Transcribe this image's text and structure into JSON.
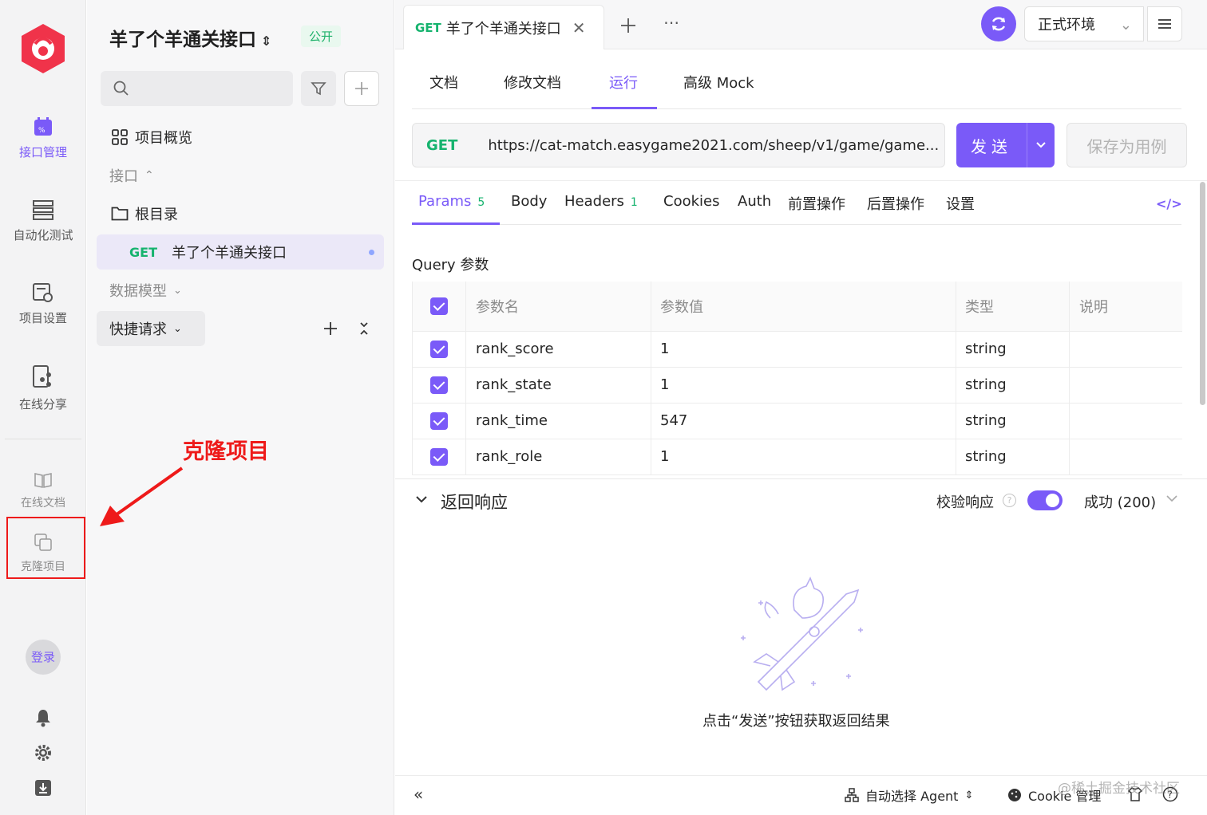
{
  "rail": {
    "items": [
      {
        "label": "接口管理",
        "icon": "api-icon"
      },
      {
        "label": "自动化测试",
        "icon": "automation-icon"
      },
      {
        "label": "项目设置",
        "icon": "settings-icon"
      },
      {
        "label": "在线分享",
        "icon": "share-icon"
      }
    ],
    "online_docs": "在线文档",
    "clone_project": "克隆项目",
    "login": "登录"
  },
  "tree": {
    "project_name": "羊了个羊通关接口",
    "public_badge": "公开",
    "search_placeholder": "",
    "overview": "项目概览",
    "section_api": "接口",
    "root_folder": "根目录",
    "api_method": "GET",
    "api_name": "羊了个羊通关接口",
    "data_model": "数据模型",
    "quick_request": "快捷请求"
  },
  "annotation": {
    "text": "克隆项目",
    "color": "#ee1a1a"
  },
  "topbar": {
    "tab_method": "GET",
    "tab_title": "羊了个羊通关接口",
    "environment": "正式环境"
  },
  "doc_tabs": [
    "文档",
    "修改文档",
    "运行",
    "高级 Mock"
  ],
  "request": {
    "method": "GET",
    "url": "https://cat-match.easygame2021.com/sheep/v1/game/game...",
    "send": "发送",
    "save_case": "保存为用例"
  },
  "param_tabs": [
    {
      "label": "Params",
      "count": "5"
    },
    {
      "label": "Body",
      "count": ""
    },
    {
      "label": "Headers",
      "count": "1"
    },
    {
      "label": "Cookies",
      "count": ""
    },
    {
      "label": "Auth",
      "count": ""
    },
    {
      "label": "前置操作",
      "count": ""
    },
    {
      "label": "后置操作",
      "count": ""
    },
    {
      "label": "设置",
      "count": ""
    }
  ],
  "query": {
    "label": "Query 参数",
    "headers": [
      "参数名",
      "参数值",
      "类型",
      "说明"
    ],
    "rows": [
      {
        "name": "rank_score",
        "value": "1",
        "type": "string",
        "desc": ""
      },
      {
        "name": "rank_state",
        "value": "1",
        "type": "string",
        "desc": ""
      },
      {
        "name": "rank_time",
        "value": "547",
        "type": "string",
        "desc": ""
      },
      {
        "name": "rank_role",
        "value": "1",
        "type": "string",
        "desc": ""
      }
    ]
  },
  "response": {
    "title": "返回响应",
    "verify": "校验响应",
    "status": "成功 (200)",
    "empty_hint": "点击“发送”按钮获取返回结果"
  },
  "footer": {
    "agent": "自动选择 Agent",
    "cookie": "Cookie 管理",
    "watermark": "@稀土掘金技术社区"
  },
  "colors": {
    "accent": "#7a5af8",
    "get": "#16b36e"
  }
}
